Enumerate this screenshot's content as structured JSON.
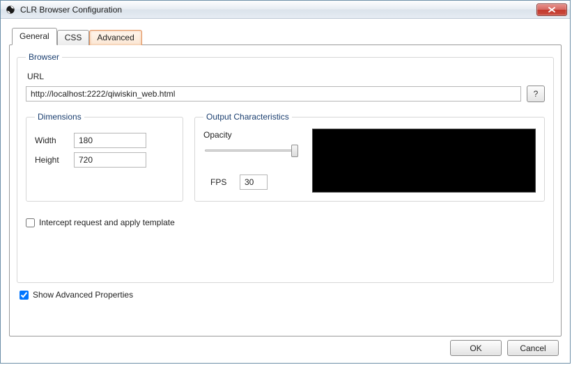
{
  "window": {
    "title": "CLR Browser Configuration"
  },
  "tabs": {
    "general": "General",
    "css": "CSS",
    "advanced": "Advanced"
  },
  "browser_group": {
    "legend": "Browser",
    "url_label": "URL",
    "url_value": "http://localhost:2222/qiwiskin_web.html",
    "help_label": "?"
  },
  "dimensions": {
    "legend": "Dimensions",
    "width_label": "Width",
    "width_value": "180",
    "height_label": "Height",
    "height_value": "720"
  },
  "intercept": {
    "label": "Intercept request and apply template",
    "checked": false
  },
  "output": {
    "legend": "Output Characteristics",
    "opacity_label": "Opacity",
    "opacity_value": 100,
    "fps_label": "FPS",
    "fps_value": "30"
  },
  "show_advanced": {
    "label": "Show Advanced Properties",
    "checked": true
  },
  "buttons": {
    "ok": "OK",
    "cancel": "Cancel"
  }
}
